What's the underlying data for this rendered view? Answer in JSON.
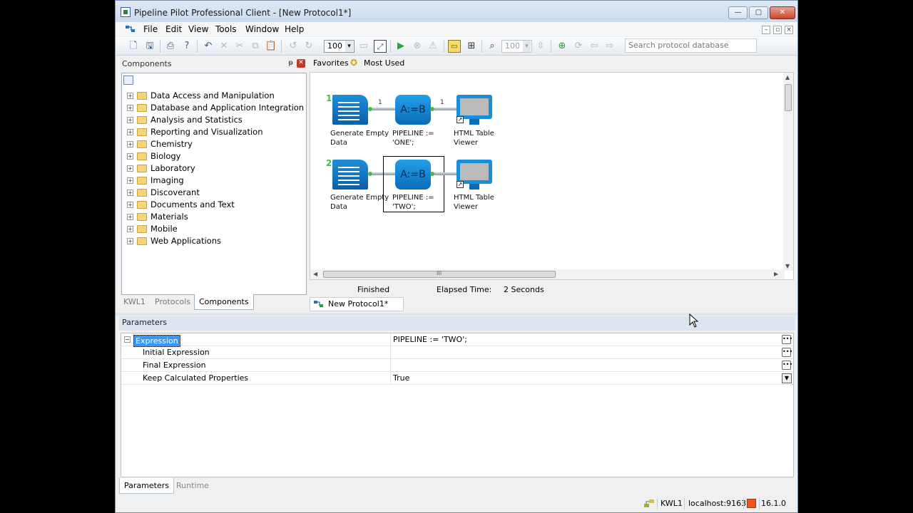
{
  "window": {
    "title": "Pipeline Pilot Professional Client - [New Protocol1*]",
    "min_label": "—",
    "max_label": "▢",
    "close_label": "✕"
  },
  "menu": {
    "items": [
      "File",
      "Edit",
      "View",
      "Tools",
      "Window",
      "Help"
    ]
  },
  "toolbar": {
    "zoom_value": "100",
    "zoom2_value": "100",
    "search_placeholder": "Search protocol database"
  },
  "components_panel": {
    "title": "Components",
    "pin_label": "ᵽ",
    "close_label": "✕",
    "tree": [
      "Data Access and Manipulation",
      "Database and Application Integration",
      "Analysis and Statistics",
      "Reporting and Visualization",
      "Chemistry",
      "Biology",
      "Laboratory",
      "Imaging",
      "Discoverant",
      "Documents and Text",
      "Materials",
      "Mobile",
      "Web Applications"
    ],
    "tabs": [
      "KWL1",
      "Protocols",
      "Components"
    ],
    "active_tab": "Components"
  },
  "canvas": {
    "favorites_label": "Favorites",
    "most_used_label": "Most Used",
    "rows": [
      {
        "number": "1",
        "pipe1": "1",
        "pipe2": "1",
        "source_label": "Generate Empty\nData",
        "calc_text": "A:=B",
        "calc_label": "PIPELINE :=\n'ONE';",
        "viewer_label": "HTML Table\nViewer"
      },
      {
        "number": "2",
        "source_label": "Generate Empty\nData",
        "calc_text": "A:=B",
        "calc_label": "PIPELINE :=\n'TWO';",
        "viewer_label": "HTML Table\nViewer"
      }
    ],
    "scroll_grip": "III",
    "status": "Finished",
    "elapsed_label": "Elapsed Time:",
    "elapsed_value": "2 Seconds",
    "doc_tab": "New Protocol1*"
  },
  "parameters": {
    "title": "Parameters",
    "rows": [
      {
        "name": "Expression",
        "value": "PIPELINE := 'TWO';"
      },
      {
        "name": "Initial Expression",
        "value": ""
      },
      {
        "name": "Final Expression",
        "value": ""
      },
      {
        "name": "Keep Calculated Properties",
        "value": "True"
      }
    ],
    "tabs": [
      "Parameters",
      "Runtime"
    ],
    "active_tab": "Parameters"
  },
  "statusbar": {
    "user": "KWL1",
    "server": "localhost:9163",
    "version": "16.1.0"
  },
  "icons": {
    "accent": "#0b6cb8",
    "port": "#47b847",
    "row_number": "#4ab845"
  }
}
